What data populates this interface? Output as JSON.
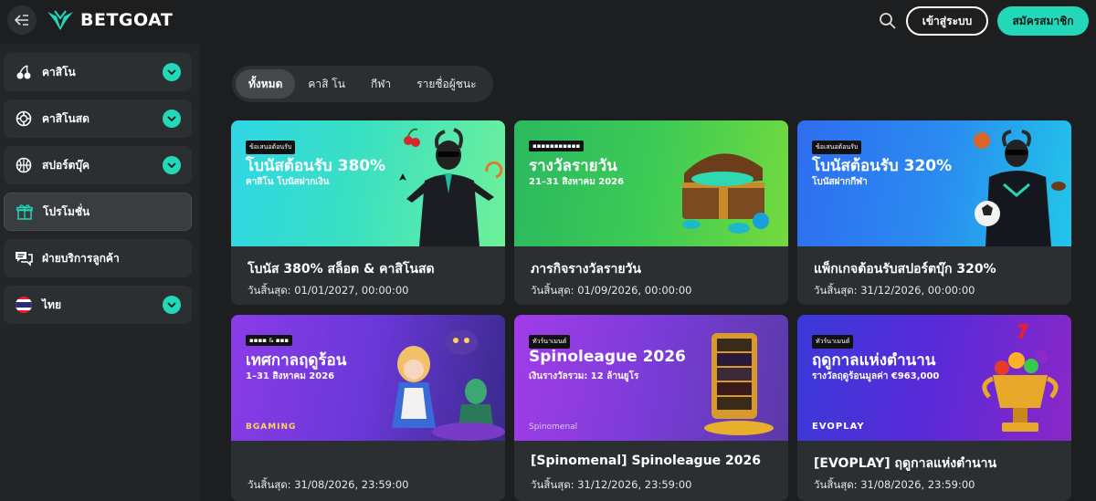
{
  "header": {
    "logo_text": "BETGOAT",
    "login_label": "เข้าสู่ระบบ",
    "signup_label": "สมัครสมาชิก",
    "accent": "#22d8b8"
  },
  "sidebar": {
    "items": [
      {
        "label": "คาสิโน",
        "icon": "cherries-icon",
        "expandable": true
      },
      {
        "label": "คาสิโนสด",
        "icon": "poker-chip-icon",
        "expandable": true
      },
      {
        "label": "สปอร์ตบุ๊ค",
        "icon": "basketball-icon",
        "expandable": true
      },
      {
        "label": "โปรโมชั่น",
        "icon": "gift-icon",
        "expandable": false,
        "active": true
      },
      {
        "label": "ฝ่ายบริการลูกค้า",
        "icon": "chat-icon",
        "expandable": false
      },
      {
        "label": "ไทย",
        "icon": "thai-flag-icon",
        "expandable": true
      }
    ]
  },
  "tabs": [
    {
      "label": "ทั้งหมด",
      "active": true
    },
    {
      "label": "คาสิ โน",
      "active": false
    },
    {
      "label": "กีฬา",
      "active": false
    },
    {
      "label": "รายชื่อผู้ชนะ",
      "active": false
    }
  ],
  "cards": [
    {
      "tag": "ข้อเสนอต้อนรับ",
      "banner_title": "โบนัสต้อนรับ 380%",
      "banner_sub": "คาสิโน โบนัสฝากเงิน",
      "brand": "",
      "title": "โบนัส 380% สล็อต & คาสิโนสด",
      "date": "วันสิ้นสุด: 01/01/2027, 00:00:00"
    },
    {
      "tag": "▪▪▪▪▪▪▪▪▪▪▪",
      "banner_title": "รางวัลรายวัน",
      "banner_sub": "21–31 สิงหาคม 2026",
      "brand": "",
      "title": "ภารกิจรางวัลรายวัน",
      "date": "วันสิ้นสุด: 01/09/2026, 00:00:00"
    },
    {
      "tag": "ข้อเสนอต้อนรับ",
      "banner_title": "โบนัสต้อนรับ 320%",
      "banner_sub": "โบนัสฝากกีฬา",
      "brand": "",
      "title": "แพ็กเกจต้อนรับสปอร์ตบุ๊ก 320%",
      "date": "วันสิ้นสุด: 31/12/2026, 00:00:00"
    },
    {
      "tag": "▪▪▪▪ & ▪▪▪",
      "banner_title": "เทศกาลฤดูร้อน",
      "banner_sub": "1–31 สิงหาคม 2026",
      "brand": "BGAMING",
      "title": "",
      "date": "วันสิ้นสุด: 31/08/2026, 23:59:00"
    },
    {
      "tag": "ทัวร์นาเมนต์",
      "banner_title": "Spinoleague 2026",
      "banner_sub": "เงินรางวัลรวม: 12 ล้านยูโร",
      "brand": "Spinomenal",
      "title": "[Spinomenal] Spinoleague 2026",
      "date": "วันสิ้นสุด: 31/12/2026, 23:59:00"
    },
    {
      "tag": "ทัวร์นาเมนต์",
      "banner_title": "ฤดูกาลแห่งตำนาน",
      "banner_sub": "รางวัลฤดูร้อนมูลค่า €963,000",
      "brand": "EVOPLAY",
      "title": "[EVOPLAY] ฤดูกาลแห่งตำนาน",
      "date": "วันสิ้นสุด: 31/08/2026, 23:59:00"
    }
  ]
}
